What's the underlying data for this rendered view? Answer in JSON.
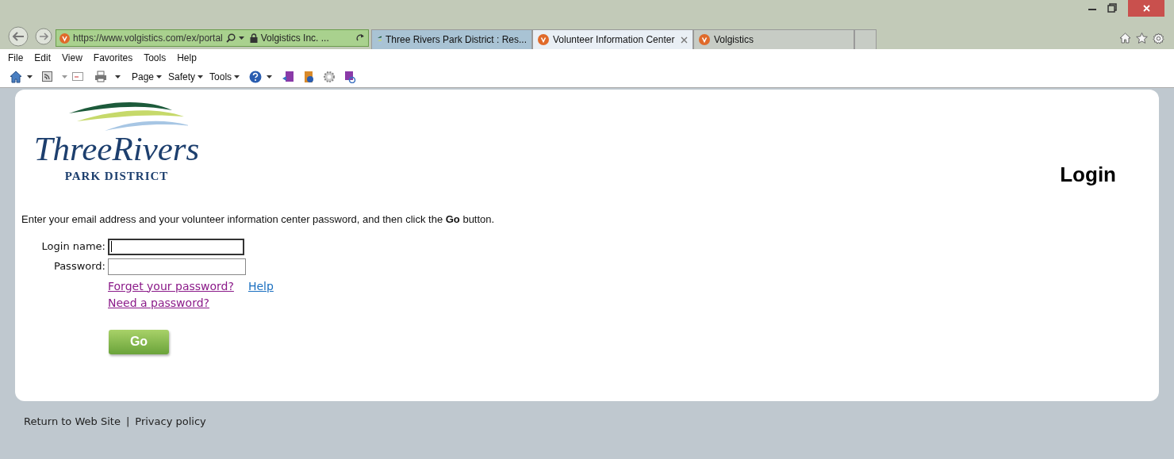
{
  "address_bar": {
    "url": "https://www.volgistics.com/ex/portal",
    "site_identity": "Volgistics Inc. ..."
  },
  "tabs": [
    {
      "label": "Three Rivers Park District : Res...",
      "selected": false,
      "kind": "waves"
    },
    {
      "label": "Volunteer Information Center",
      "selected": true,
      "kind": "v"
    },
    {
      "label": "Volgistics",
      "selected": false,
      "kind": "v"
    }
  ],
  "menu_bar": [
    "File",
    "Edit",
    "View",
    "Favorites",
    "Tools",
    "Help"
  ],
  "command_bar": [
    "Page",
    "Safety",
    "Tools"
  ],
  "logo": {
    "name": "ThreeRivers",
    "tagline": "PARK DISTRICT"
  },
  "heading": "Login",
  "instructions": "Enter your email address and your volunteer information center password, and then click the **Go** button.",
  "form": {
    "fields": [
      {
        "label": "Login name:",
        "focused": true
      },
      {
        "label": "Password:",
        "focused": false
      }
    ],
    "links": [
      {
        "text": "Forget your password?",
        "visited": true
      },
      {
        "text": "Help",
        "visited": false
      },
      {
        "text": "Need a password?",
        "visited": true
      }
    ],
    "submit": "Go"
  },
  "footer": {
    "links": [
      "Return to Web Site",
      "Privacy policy"
    ],
    "separator": "|"
  }
}
